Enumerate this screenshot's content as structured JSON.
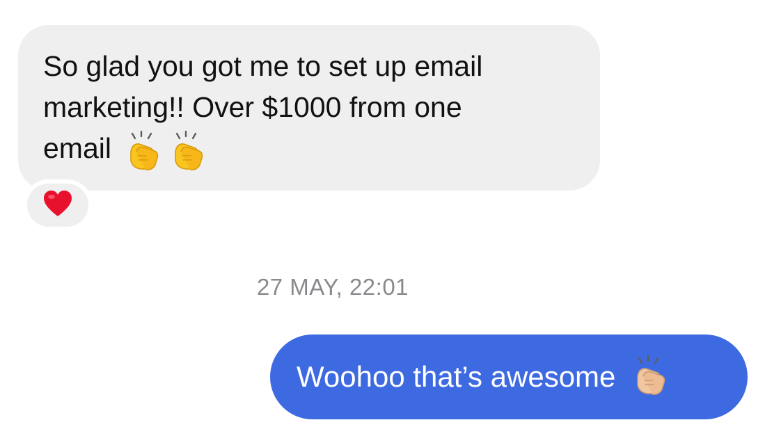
{
  "conversation": {
    "incoming_message": {
      "text": "So glad you got me to set up email\nmarketing!! Over $1000 from one\nemail",
      "emojis": [
        "clapping-hands-icon",
        "clapping-hands-icon"
      ],
      "reaction": "heart-icon"
    },
    "timestamp": "27 MAY, 22:01",
    "outgoing_message": {
      "text": "Woohoo that’s awesome",
      "emoji": "clapping-hands-icon"
    }
  },
  "colors": {
    "incoming_bubble": "#efeff0",
    "outgoing_bubble": "#3e6ae1",
    "timestamp": "#8a8a8e",
    "heart": "#e8112d",
    "clap_yellow": "#f9c520",
    "clap_light_skin": "#f1c7a1"
  }
}
